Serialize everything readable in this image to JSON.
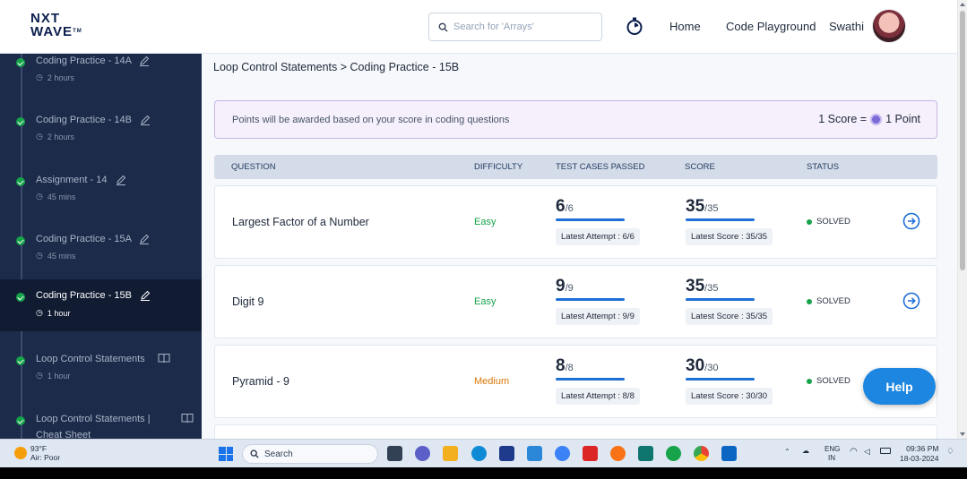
{
  "header": {
    "logo": {
      "line1": "NXT",
      "line2": "WAVE",
      "tm": "TM"
    },
    "search_placeholder": "Search for 'Arrays'",
    "nav": {
      "home": "Home",
      "playground": "Code Playground",
      "user": "Swathi"
    }
  },
  "sidebar": {
    "items": [
      {
        "title": "Coding Practice - 14A",
        "duration": "2 hours",
        "icon": "pencil-icon"
      },
      {
        "title": "Coding Practice - 14B",
        "duration": "2 hours",
        "icon": "pencil-icon"
      },
      {
        "title": "Assignment - 14",
        "duration": "45 mins",
        "icon": "pencil-icon"
      },
      {
        "title": "Coding Practice - 15A",
        "duration": "45 mins",
        "icon": "pencil-icon"
      },
      {
        "title": "Coding Practice - 15B",
        "duration": "1 hour",
        "icon": "pencil-icon",
        "active": true
      },
      {
        "title": "Loop Control Statements",
        "duration": "1 hour",
        "icon": "book-icon"
      },
      {
        "title": "Loop Control Statements |",
        "title2": "Cheat Sheet",
        "icon": "book-icon"
      }
    ]
  },
  "main": {
    "breadcrumb": "Loop Control Statements > Coding Practice - 15B",
    "banner": {
      "note": "Points will be awarded based on your score in coding questions",
      "score_text": "1 Score =",
      "point_text": "1 Point"
    },
    "columns": [
      "QUESTION",
      "DIFFICULTY",
      "TEST CASES PASSED",
      "SCORE",
      "STATUS"
    ],
    "rows": [
      {
        "question": "Largest Factor of a Number",
        "difficulty": "Easy",
        "passed": "6",
        "total": "/6",
        "attempt": "Latest Attempt : 6/6",
        "score": "35",
        "score_total": "/35",
        "latest_score": "Latest Score : 35/35",
        "status": "SOLVED"
      },
      {
        "question": "Digit 9",
        "difficulty": "Easy",
        "passed": "9",
        "total": "/9",
        "attempt": "Latest Attempt : 9/9",
        "score": "35",
        "score_total": "/35",
        "latest_score": "Latest Score : 35/35",
        "status": "SOLVED"
      },
      {
        "question": "Pyramid - 9",
        "difficulty": "Medium",
        "passed": "8",
        "total": "/8",
        "attempt": "Latest Attempt : 8/8",
        "score": "30",
        "score_total": "/30",
        "latest_score": "Latest Score : 30/30",
        "status": "SOLVED"
      }
    ],
    "help": "Help"
  },
  "taskbar": {
    "weather_temp": "93°F",
    "weather_desc": "Air: Poor",
    "search": "Search",
    "lang1": "ENG",
    "lang2": "IN",
    "time": "09:36 PM",
    "date": "18-03-2024"
  },
  "colors": {
    "sidebar": "#1c2b4a",
    "accent": "#1d86e0",
    "easy": "#16a34a",
    "medium": "#d97706"
  }
}
